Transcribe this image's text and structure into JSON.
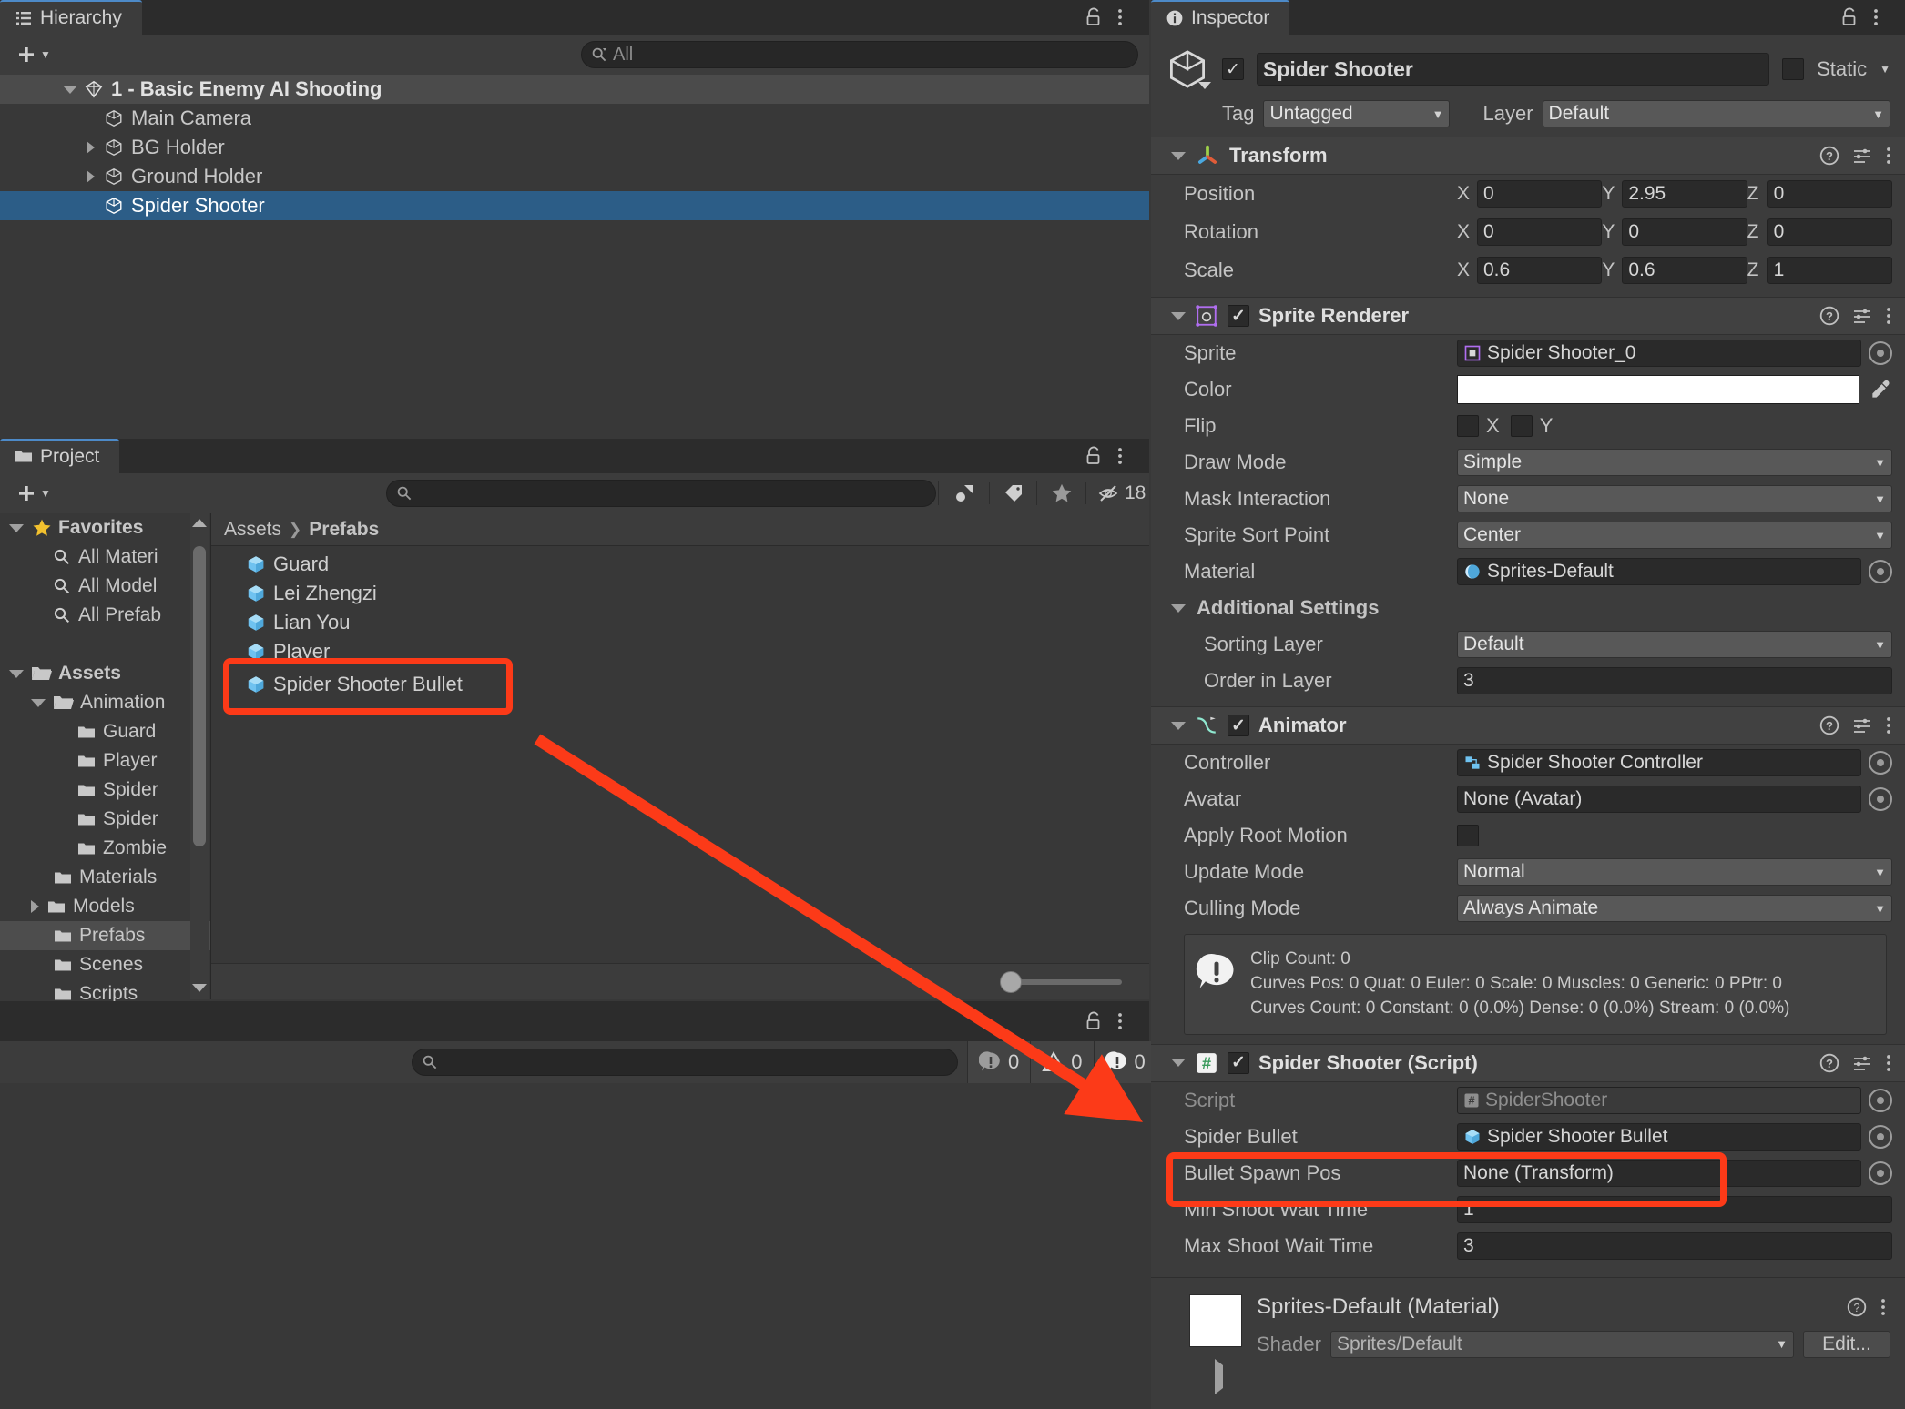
{
  "hierarchy": {
    "tab_label": "Hierarchy",
    "search_placeholder": "All",
    "items": [
      {
        "label": "1 - Basic Enemy AI Shooting",
        "type": "scene",
        "depth": 0,
        "expanded": true
      },
      {
        "label": "Main Camera",
        "type": "gameobject",
        "depth": 1,
        "expanded": false
      },
      {
        "label": "BG Holder",
        "type": "gameobject",
        "depth": 1,
        "expanded": false,
        "has_children": true
      },
      {
        "label": "Ground Holder",
        "type": "gameobject",
        "depth": 1,
        "expanded": false,
        "has_children": true
      },
      {
        "label": "Spider Shooter",
        "type": "gameobject",
        "depth": 1,
        "selected": true
      }
    ]
  },
  "project": {
    "tab_label": "Project",
    "search_placeholder": "",
    "hidden_count": "18",
    "breadcrumb": [
      "Assets",
      "Prefabs"
    ],
    "tree": [
      {
        "label": "Favorites",
        "kind": "favorites",
        "depth": 0,
        "expanded": true
      },
      {
        "label": "All Materi",
        "kind": "search",
        "depth": 1
      },
      {
        "label": "All Model",
        "kind": "search",
        "depth": 1
      },
      {
        "label": "All Prefab",
        "kind": "search",
        "depth": 1
      },
      {
        "label": "",
        "kind": "spacer",
        "depth": 0
      },
      {
        "label": "Assets",
        "kind": "folder-open",
        "depth": 0,
        "expanded": true
      },
      {
        "label": "Animation",
        "kind": "folder-open",
        "depth": 1,
        "expanded": true
      },
      {
        "label": "Guard",
        "kind": "folder",
        "depth": 2
      },
      {
        "label": "Player",
        "kind": "folder",
        "depth": 2
      },
      {
        "label": "Spider",
        "kind": "folder",
        "depth": 2
      },
      {
        "label": "Spider",
        "kind": "folder",
        "depth": 2
      },
      {
        "label": "Zombie",
        "kind": "folder",
        "depth": 2
      },
      {
        "label": "Materials",
        "kind": "folder",
        "depth": 1
      },
      {
        "label": "Models",
        "kind": "folder",
        "depth": 1,
        "collapsed": true
      },
      {
        "label": "Prefabs",
        "kind": "folder",
        "depth": 1,
        "selected": true
      },
      {
        "label": "Scenes",
        "kind": "folder",
        "depth": 1
      },
      {
        "label": "Scripts",
        "kind": "folder",
        "depth": 1
      }
    ],
    "assets": [
      {
        "label": "Guard"
      },
      {
        "label": "Lei Zhengzi"
      },
      {
        "label": "Lian You"
      },
      {
        "label": "Player"
      },
      {
        "label": "Spider Shooter Bullet",
        "highlighted": true
      }
    ]
  },
  "console": {
    "search_placeholder": "",
    "log_count": "0",
    "warning_count": "0",
    "error_count": "0"
  },
  "inspector": {
    "tab_label": "Inspector",
    "object_name": "Spider Shooter",
    "object_enabled": true,
    "static_label": "Static",
    "static_checked": false,
    "tag_label": "Tag",
    "tag_value": "Untagged",
    "layer_label": "Layer",
    "layer_value": "Default",
    "transform": {
      "title": "Transform",
      "rows": [
        {
          "label": "Position",
          "x": "0",
          "y": "2.95",
          "z": "0"
        },
        {
          "label": "Rotation",
          "x": "0",
          "y": "0",
          "z": "0"
        },
        {
          "label": "Scale",
          "x": "0.6",
          "y": "0.6",
          "z": "1"
        }
      ],
      "axes": [
        "X",
        "Y",
        "Z"
      ]
    },
    "sprite_renderer": {
      "title": "Sprite Renderer",
      "enabled": true,
      "sprite_label": "Sprite",
      "sprite_value": "Spider Shooter_0",
      "color_label": "Color",
      "color_value": "#ffffff",
      "flip_label": "Flip",
      "flip_x_label": "X",
      "flip_y_label": "Y",
      "flip_x": false,
      "flip_y": false,
      "draw_mode_label": "Draw Mode",
      "draw_mode_value": "Simple",
      "mask_interaction_label": "Mask Interaction",
      "mask_interaction_value": "None",
      "sprite_sort_point_label": "Sprite Sort Point",
      "sprite_sort_point_value": "Center",
      "material_label": "Material",
      "material_value": "Sprites-Default",
      "additional_settings_label": "Additional Settings",
      "sorting_layer_label": "Sorting Layer",
      "sorting_layer_value": "Default",
      "order_in_layer_label": "Order in Layer",
      "order_in_layer_value": "3"
    },
    "animator": {
      "title": "Animator",
      "enabled": true,
      "controller_label": "Controller",
      "controller_value": "Spider Shooter Controller",
      "avatar_label": "Avatar",
      "avatar_value": "None (Avatar)",
      "apply_root_motion_label": "Apply Root Motion",
      "apply_root_motion": false,
      "update_mode_label": "Update Mode",
      "update_mode_value": "Normal",
      "culling_mode_label": "Culling Mode",
      "culling_mode_value": "Always Animate",
      "info_line1": "Clip Count: 0",
      "info_line2": "Curves Pos: 0 Quat: 0 Euler: 0 Scale: 0 Muscles: 0 Generic: 0 PPtr: 0",
      "info_line3": "Curves Count: 0 Constant: 0 (0.0%) Dense: 0 (0.0%) Stream: 0 (0.0%)"
    },
    "script_component": {
      "title": "Spider Shooter (Script)",
      "enabled": true,
      "script_label": "Script",
      "script_value": "SpiderShooter",
      "spider_bullet_label": "Spider Bullet",
      "spider_bullet_value": "Spider Shooter Bullet",
      "bullet_spawn_pos_label": "Bullet Spawn Pos",
      "bullet_spawn_pos_value": "None (Transform)",
      "min_shoot_wait_label": "Min Shoot Wait Time",
      "min_shoot_wait_value": "1",
      "max_shoot_wait_label": "Max Shoot Wait Time",
      "max_shoot_wait_value": "3"
    },
    "material_preview": {
      "title": "Sprites-Default (Material)",
      "shader_label": "Shader",
      "shader_value": "Sprites/Default",
      "edit_label": "Edit..."
    }
  },
  "annotation": {
    "accent_color": "#fc3a18"
  }
}
